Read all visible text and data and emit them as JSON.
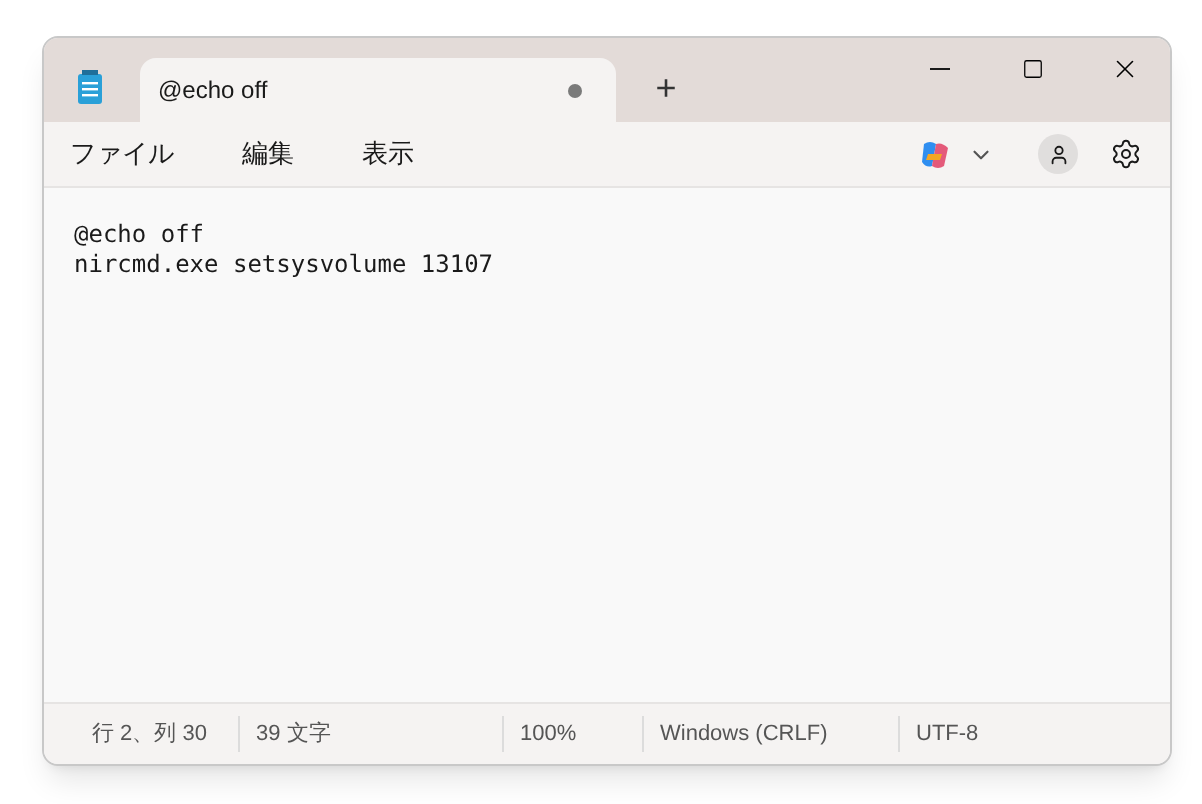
{
  "tabs": [
    {
      "label": "@echo off",
      "selected": true,
      "modified": true
    }
  ],
  "new_tab": "+",
  "menu": [
    "ファイル",
    "編集",
    "表示"
  ],
  "editor": {
    "lines": [
      "@echo off",
      "nircmd.exe setsysvolume 13107"
    ]
  },
  "status_bar": [
    "行 2、列 30",
    "39 文字",
    "100%",
    "Windows (CRLF)",
    "UTF-8"
  ]
}
